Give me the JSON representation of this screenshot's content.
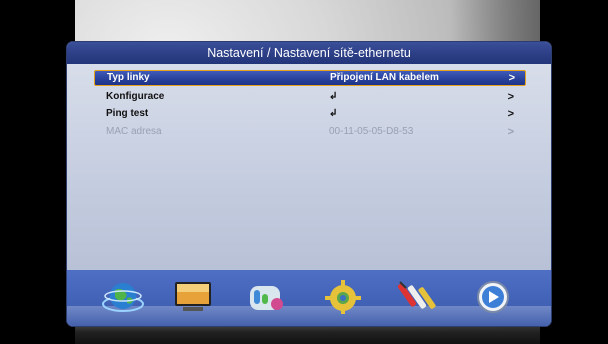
{
  "title": "Nastavení / Nastavení sítě-ethernetu",
  "rows": [
    {
      "label": "Typ linky",
      "value": "Připojení LAN kabelem",
      "arrow": ">"
    },
    {
      "label": "Konfigurace",
      "value": "↲",
      "arrow": ">"
    },
    {
      "label": "Ping test",
      "value": "↲",
      "arrow": ">"
    },
    {
      "label": "MAC adresa",
      "value": "00-11-05-05-D8-53",
      "arrow": ">"
    }
  ],
  "icons": [
    "globe-icon",
    "tv-monitor-icon",
    "media-icon",
    "settings-gear-icon",
    "cable-connectors-icon",
    "play-icon"
  ],
  "colors": {
    "title_bar": "#2c3f86",
    "selection": "#27409a",
    "selection_border": "#e6a11f",
    "icon_bar": "#4566bb"
  }
}
